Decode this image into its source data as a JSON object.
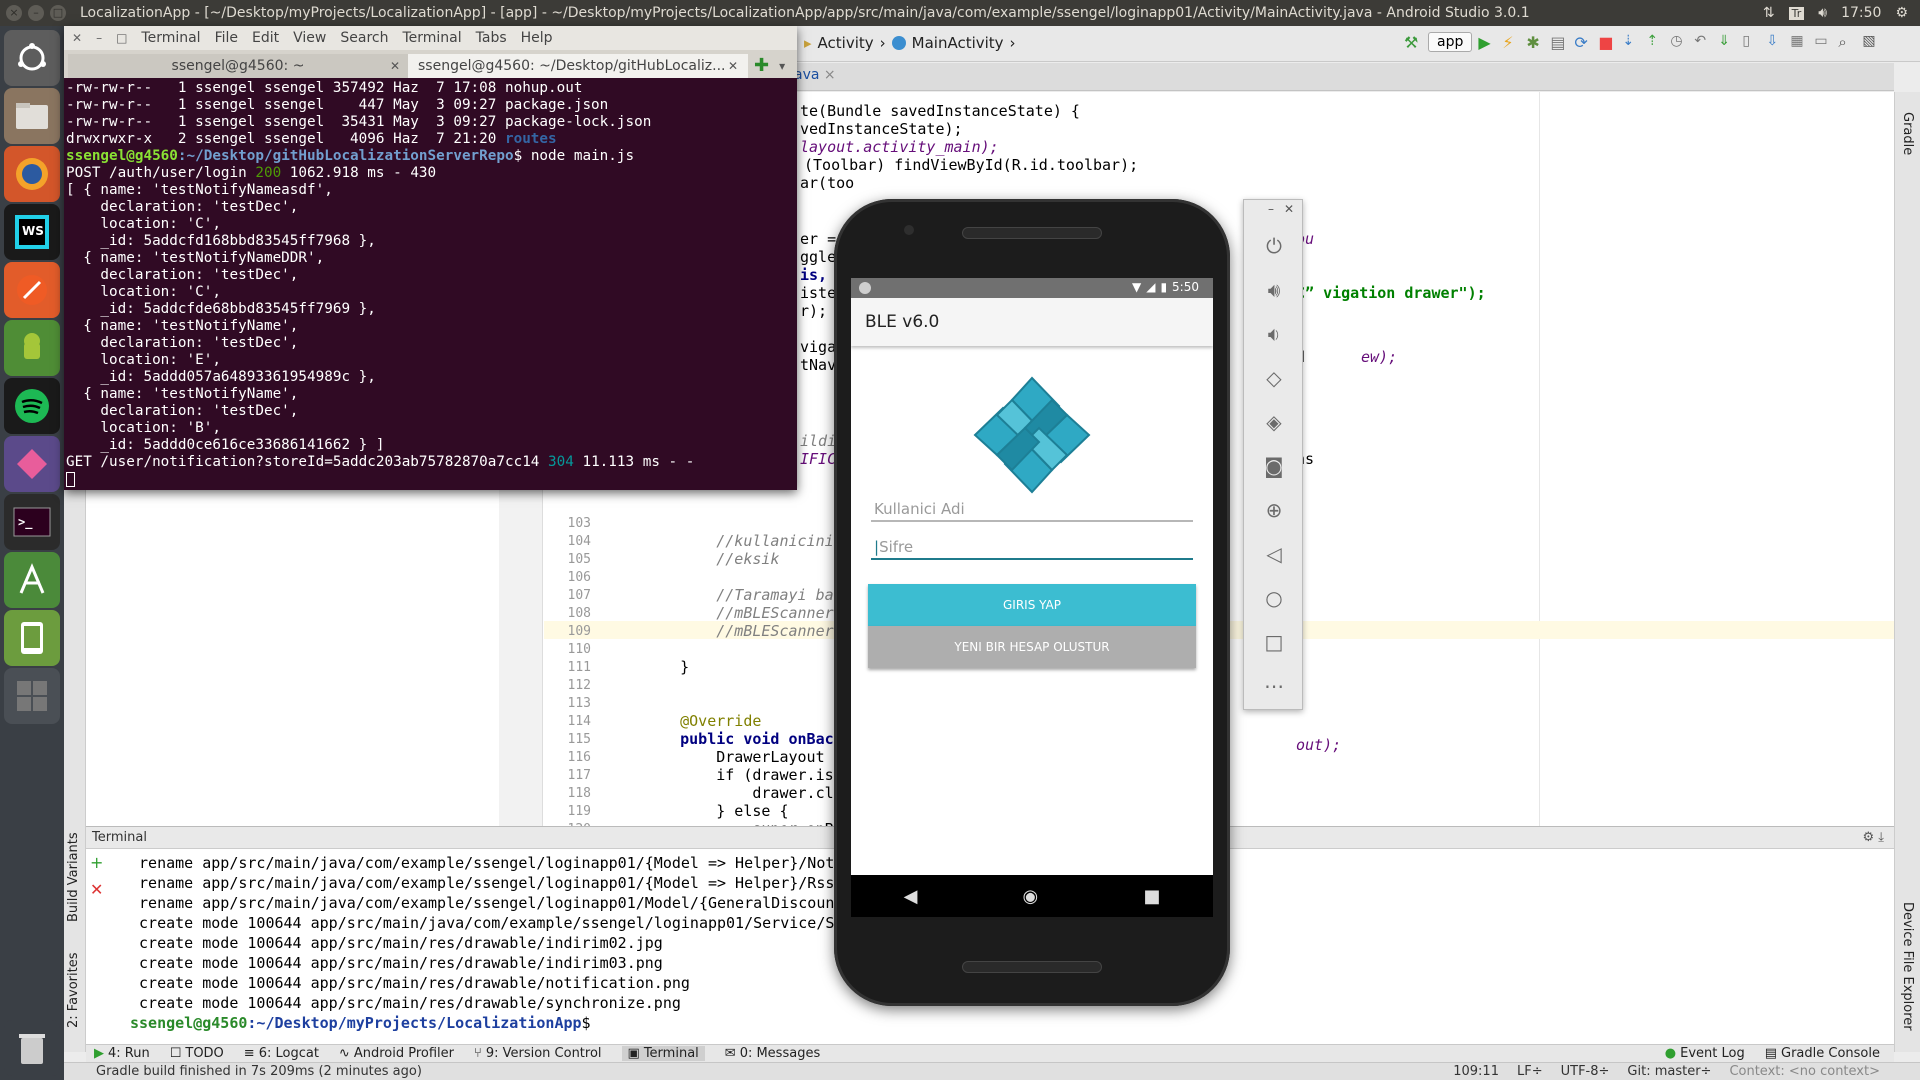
{
  "top_panel": {
    "window_title": "LocalizationApp - [~/Desktop/myProjects/LocalizationApp] - [app] - ~/Desktop/myProjects/LocalizationApp/app/src/main/java/com/example/ssengel/loginapp01/Activity/MainActivity.java - Android Studio 3.0.1",
    "keyboard_layout": "Tr",
    "clock": "17:50"
  },
  "launcher": {
    "items": [
      "ubuntu-dash-icon",
      "files-icon",
      "firefox-icon",
      "webstorm-icon",
      "postman-icon",
      "android-device-icon",
      "spotify-icon",
      "app-icon",
      "terminal-icon",
      "android-studio-icon",
      "emulator-icon",
      "workspace-icon",
      "trash-icon"
    ]
  },
  "studio": {
    "breadcrumb": [
      "Activity",
      "MainActivity"
    ],
    "run_config": "app",
    "editor_tab_fragment": "ava",
    "code_fragments": [
      "te(Bundle savedInstanceState) {",
      "vedInstanceState);",
      "layout.activity_main);",
      "(Toolbar) findViewById(R.id.toolbar);",
      "ar(too"
    ],
    "code_right_fragments": {
      "a": "ou",
      "b": "C” vigation drawer\");",
      "c": "d",
      "d": "ew);",
      "e": "ns",
      "f": "out);"
    },
    "code_left_fragments": [
      "er =",
      "ggle",
      "is,",
      "iste",
      "r);",
      "viga",
      "tNav",
      "ildi",
      "IFIC"
    ],
    "lines": [
      {
        "n": "103",
        "text": ""
      },
      {
        "n": "104",
        "text": "        //kullanicinin ilgile"
      },
      {
        "n": "105",
        "text": "        //eksik"
      },
      {
        "n": "106",
        "text": ""
      },
      {
        "n": "107",
        "text": "        //Taramayi baslat"
      },
      {
        "n": "108",
        "text": "        //mBLEScannerImpl.sca"
      },
      {
        "n": "109",
        "text": "        //mBLEScannerImpl.sen"
      },
      {
        "n": "110",
        "text": ""
      },
      {
        "n": "111",
        "text": "    }"
      },
      {
        "n": "112",
        "text": ""
      },
      {
        "n": "113",
        "text": ""
      },
      {
        "n": "114",
        "text": "    @Override"
      },
      {
        "n": "115",
        "text": "    public void onBackPressed"
      },
      {
        "n": "116",
        "text": "        DrawerLayout drawer ="
      },
      {
        "n": "117",
        "text": "        if (drawer.isDrawerOp"
      },
      {
        "n": "118",
        "text": "            drawer.closeDrawe"
      },
      {
        "n": "119",
        "text": "        } else {"
      },
      {
        "n": "120",
        "text": "            super.onBackPress"
      }
    ],
    "left_vtabs": [
      "Build Variants",
      "2: Favorites"
    ],
    "right_vtabs": [
      "Gradle",
      "Device File Explorer"
    ],
    "terminal_panel": {
      "title": "Terminal",
      "lines": [
        " rename app/src/main/java/com/example/ssengel/loginapp01/{Model => Helper}/Noti",
        " rename app/src/main/java/com/example/ssengel/loginapp01/{Model => Helper}/Rssi",
        " rename app/src/main/java/com/example/ssengel/loginapp01/Model/{GeneralDiscount",
        " create mode 100644 app/src/main/java/com/example/ssengel/loginapp01/Service/Se",
        " create mode 100644 app/src/main/res/drawable/indirim02.jpg",
        " create mode 100644 app/src/main/res/drawable/indirim03.png",
        " create mode 100644 app/src/main/res/drawable/notification.png",
        " create mode 100644 app/src/main/res/drawable/synchronize.png"
      ],
      "prompt_user": "ssengel@g4560",
      "prompt_path": ":~/Desktop/myProjects/LocalizationApp",
      "prompt_symbol": "$"
    },
    "tool_tabs": [
      "4: Run",
      "TODO",
      "6: Logcat",
      "Android Profiler",
      "9: Version Control",
      "Terminal",
      "0: Messages"
    ],
    "tool_tabs_right": [
      "Event Log",
      "Gradle Console"
    ],
    "status": {
      "message": "Gradle build finished in 7s 209ms (2 minutes ago)",
      "position": "109:11",
      "line_sep": "LF÷",
      "encoding": "UTF-8÷",
      "git": "Git: master÷",
      "context": "Context: <no context>"
    }
  },
  "terminal_window": {
    "menu": [
      "Terminal",
      "File",
      "Edit",
      "View",
      "Search",
      "Terminal",
      "Tabs",
      "Help"
    ],
    "tabs": [
      {
        "title": "ssengel@g4560: ~"
      },
      {
        "title": "ssengel@g4560: ~/Desktop/gitHubLocaliz..."
      }
    ],
    "listing": [
      "-rw-rw-r--   1 ssengel ssengel 357492 Haz  7 17:08 nohup.out",
      "-rw-rw-r--   1 ssengel ssengel    447 May  3 09:27 package.json",
      "-rw-rw-r--   1 ssengel ssengel  35431 May  3 09:27 package-lock.json"
    ],
    "dir_line_prefix": "drwxrwxr-x   2 ssengel ssengel   4096 Haz  7 21:20 ",
    "dir_name": "routes",
    "prompt_user": "ssengel@g4560",
    "prompt_path": ":~/Desktop/gitHubLocalizationServerRepo",
    "command": "$ node main.js",
    "post_line": {
      "method": "POST /auth/user/login ",
      "status": "200",
      "rest": " 1062.918 ms - 430"
    },
    "output": [
      "[ { name: 'testNotifyNameasdf',",
      "    declaration: 'testDec',",
      "    location: 'C',",
      "    _id: 5addcfd168bbd83545ff7968 },",
      "  { name: 'testNotifyNameDDR',",
      "    declaration: 'testDec',",
      "    location: 'C',",
      "    _id: 5addcfde68bbd83545ff7969 },",
      "  { name: 'testNotifyName',",
      "    declaration: 'testDec',",
      "    location: 'E',",
      "    _id: 5addd057a64893361954989c },",
      "  { name: 'testNotifyName',",
      "    declaration: 'testDec',",
      "    location: 'B',",
      "    _id: 5addd0ce616ce33686141662 } ]"
    ],
    "get_line": {
      "method": "GET /user/notification?storeId=5addc203ab75782870a7cc14 ",
      "status": "304",
      "rest": " 11.113 ms - -"
    }
  },
  "phone": {
    "status_time": "5:50",
    "app_title": "BLE v6.0",
    "username_placeholder": "Kullanici Adi",
    "password_placeholder": "Sifre",
    "login_button": "GIRIS YAP",
    "register_button": "YENI BIR HESAP OLUSTUR",
    "colors": {
      "primary_button": "#3cbdd1",
      "secondary_button": "#aeaeae",
      "logo": "#2fa9c4"
    }
  },
  "emulator_controls": [
    "power-icon",
    "volume-up-icon",
    "volume-down-icon",
    "rotate-left-icon",
    "rotate-right-icon",
    "camera-icon",
    "zoom-icon",
    "back-icon",
    "home-icon",
    "overview-icon",
    "more-icon"
  ]
}
